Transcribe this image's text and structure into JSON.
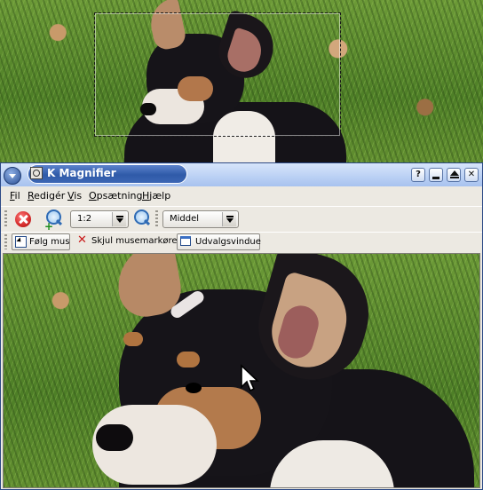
{
  "window": {
    "title": "K Magnifier",
    "controls": {
      "help": "?",
      "minimize": "",
      "maximize": "",
      "close": "✕"
    }
  },
  "menubar": [
    {
      "underlined": "F",
      "rest": "il"
    },
    {
      "underlined": "R",
      "rest": "edigér"
    },
    {
      "underlined": "V",
      "rest": "is"
    },
    {
      "underlined": "O",
      "rest": "psætning"
    },
    {
      "underlined": "H",
      "rest": "jælp"
    }
  ],
  "toolbar": {
    "zoom_value": "1:2",
    "refresh_value": "Middel"
  },
  "toolbar2": {
    "follow_mouse": "Følg mus",
    "hide_cursor": "Skjul musemarkøren",
    "selection_window": "Udvalgsvindue"
  },
  "colors": {
    "title_pill": "#2f5aa8",
    "window_bg": "#ece9e2",
    "stop_red": "#d42a2a",
    "grass_green": "#5d8a2c"
  },
  "icons": [
    "window-menu-icon",
    "app-icon",
    "help-icon",
    "minimize-icon",
    "maximize-icon",
    "close-icon",
    "stop-icon",
    "zoom-in-icon",
    "zoom-out-icon",
    "follow-mouse-icon",
    "hide-cursor-icon",
    "selection-window-icon",
    "mouse-pointer-icon"
  ]
}
